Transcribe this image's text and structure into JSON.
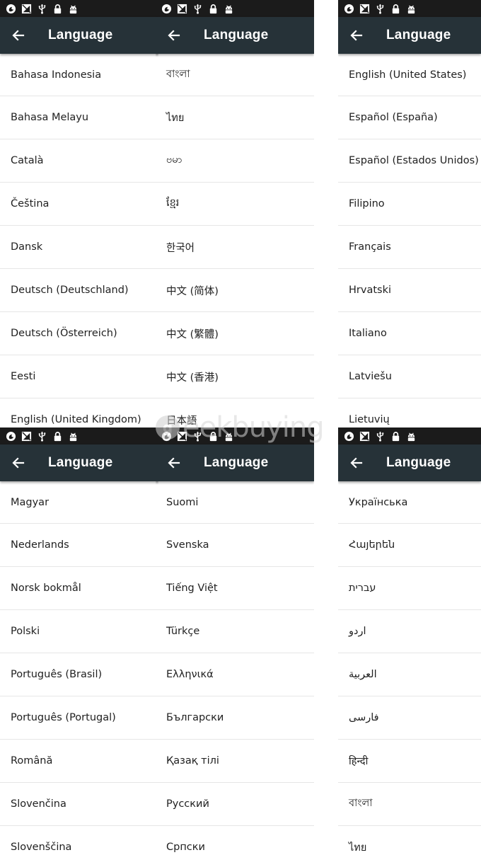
{
  "panels": [
    {
      "title": "Language",
      "languages": [
        "Bahasa Indonesia",
        "Bahasa Melayu",
        "Català",
        "Čeština",
        "Dansk",
        "Deutsch (Deutschland)",
        "Deutsch (Österreich)",
        "Eesti",
        "English (United Kingdom)"
      ]
    },
    {
      "title": "Language",
      "languages": [
        "বাংলা",
        "ไทย",
        "ဗမာ",
        "ខ្មែរ",
        "한국어",
        "中文 (简体)",
        "中文 (繁體)",
        "中文 (香港)",
        "日本語"
      ]
    },
    {
      "title": "Language",
      "languages": [
        "English (United States)",
        "Español (España)",
        "Español (Estados Unidos)",
        "Filipino",
        "Français",
        "Hrvatski",
        "Italiano",
        "Latviešu",
        "Lietuvių"
      ]
    },
    {
      "title": "Language",
      "languages": [
        "Magyar",
        "Nederlands",
        "Norsk bokmål",
        "Polski",
        "Português (Brasil)",
        "Português (Portugal)",
        "Română",
        "Slovenčina",
        "Slovenščina"
      ]
    },
    {
      "title": "Language",
      "languages": [
        "Suomi",
        "Svenska",
        "Tiếng Việt",
        "Türkçe",
        "Ελληνικά",
        "Български",
        "Қазақ тілі",
        "Русский",
        "Српски"
      ]
    },
    {
      "title": "Language",
      "languages": [
        "Українська",
        "Հայերեն",
        "עברית",
        "اردو",
        "العربية",
        "فارسی",
        "हिन्दी",
        "বাংলা",
        "ไทย"
      ]
    }
  ],
  "status_icons": [
    "vpn-key-icon",
    "no-signal-icon",
    "usb-icon",
    "lock-icon",
    "android-debug-icon"
  ],
  "watermark": {
    "logo_letter": "g",
    "text": "eekbuying"
  },
  "colors": {
    "status_bar": "#1b1b1b",
    "app_bar": "#263238",
    "title": "#ffffff",
    "text": "#212121",
    "divider": "#e6e6e6"
  }
}
